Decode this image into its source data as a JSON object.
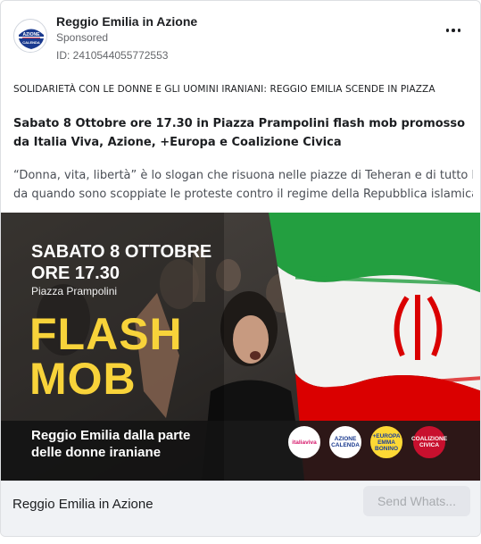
{
  "ad": {
    "page_name": "Reggio Emilia in Azione",
    "sponsored": "Sponsored",
    "id_label": "ID: 2410544055772553",
    "headline": "SOLIDARIETÀ CON LE DONNE E GLI UOMINI IRANIANI: REGGIO EMILIA SCENDE IN PIAZZA",
    "subhead": "Sabato 8 Ottobre ore 17.30 in Piazza Prampolini flash mob promosso da Italia Viva, Azione, +Europa e Coalizione Civica",
    "desc_line1": "“Donna, vita, libertà” è lo slogan che risuona nelle piazze di Teheran e di tutto l’Iran",
    "desc_line2": "da quando sono scoppiate le proteste contro il regime della Repubblica islamica i..."
  },
  "creative": {
    "date": "SABATO 8 OTTOBRE",
    "time": "ORE 17.30",
    "place": "Piazza Prampolini",
    "flash": "FLASH",
    "mob": "MOB",
    "tag_line1": "Reggio Emilia dalla parte",
    "tag_line2": "delle donne iraniane",
    "logos": {
      "italia_viva": "italiaviva",
      "azione": "AZIONE",
      "azione_sub": "CALENDA",
      "europa": "+EUROPA",
      "europa_sub": "EMMA BONINO",
      "coalizione": "COALIZIONE CIVICA"
    },
    "colors": {
      "flag_green": "#239f40",
      "flag_red": "#da0000",
      "accent_yellow": "#f8d33a"
    }
  },
  "avatar": {
    "text": "AZIONE",
    "sub": "CALENDA"
  },
  "footer": {
    "page_name": "Reggio Emilia in Azione",
    "cta_label": "Send Whats..."
  }
}
